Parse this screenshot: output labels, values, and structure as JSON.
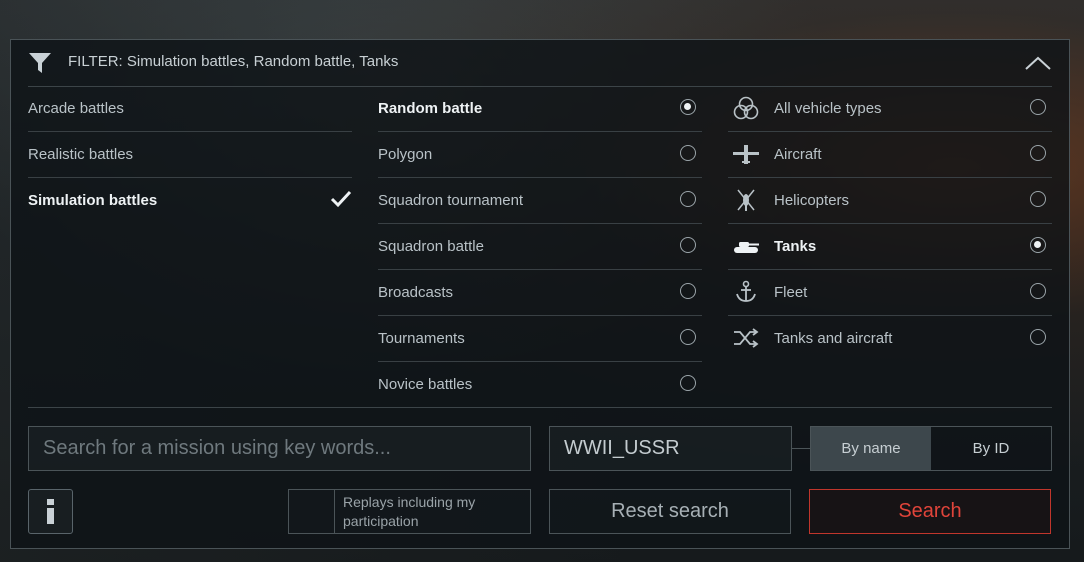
{
  "filter": {
    "title": "FILTER: Simulation battles, Random battle, Tanks"
  },
  "difficulty": {
    "items": [
      {
        "label": "Arcade battles",
        "selected": false
      },
      {
        "label": "Realistic battles",
        "selected": false
      },
      {
        "label": "Simulation battles",
        "selected": true
      }
    ]
  },
  "modes": {
    "items": [
      {
        "label": "Random battle",
        "selected": true
      },
      {
        "label": "Polygon",
        "selected": false
      },
      {
        "label": "Squadron tournament",
        "selected": false
      },
      {
        "label": "Squadron battle",
        "selected": false
      },
      {
        "label": "Broadcasts",
        "selected": false
      },
      {
        "label": "Tournaments",
        "selected": false
      },
      {
        "label": "Novice battles",
        "selected": false
      }
    ]
  },
  "vehicles": {
    "items": [
      {
        "label": "All vehicle types",
        "icon": "all-vehicles-icon",
        "selected": false
      },
      {
        "label": "Aircraft",
        "icon": "aircraft-icon",
        "selected": false
      },
      {
        "label": "Helicopters",
        "icon": "helicopter-icon",
        "selected": false
      },
      {
        "label": "Tanks",
        "icon": "tank-icon",
        "selected": true
      },
      {
        "label": "Fleet",
        "icon": "anchor-icon",
        "selected": false
      },
      {
        "label": "Tanks and aircraft",
        "icon": "shuffle-icon",
        "selected": false
      }
    ]
  },
  "search": {
    "placeholder": "Search for a mission using key words...",
    "mission_value": "WWII_USSR",
    "by_name": "By name",
    "by_id": "By ID",
    "active_mode": "By name"
  },
  "replays_label": "Replays including my participation",
  "reset_label": "Reset search",
  "search_label": "Search",
  "colors": {
    "accent_red": "#e0443a",
    "panel_border": "#4a5357",
    "selected_text": "#eef2f4"
  }
}
